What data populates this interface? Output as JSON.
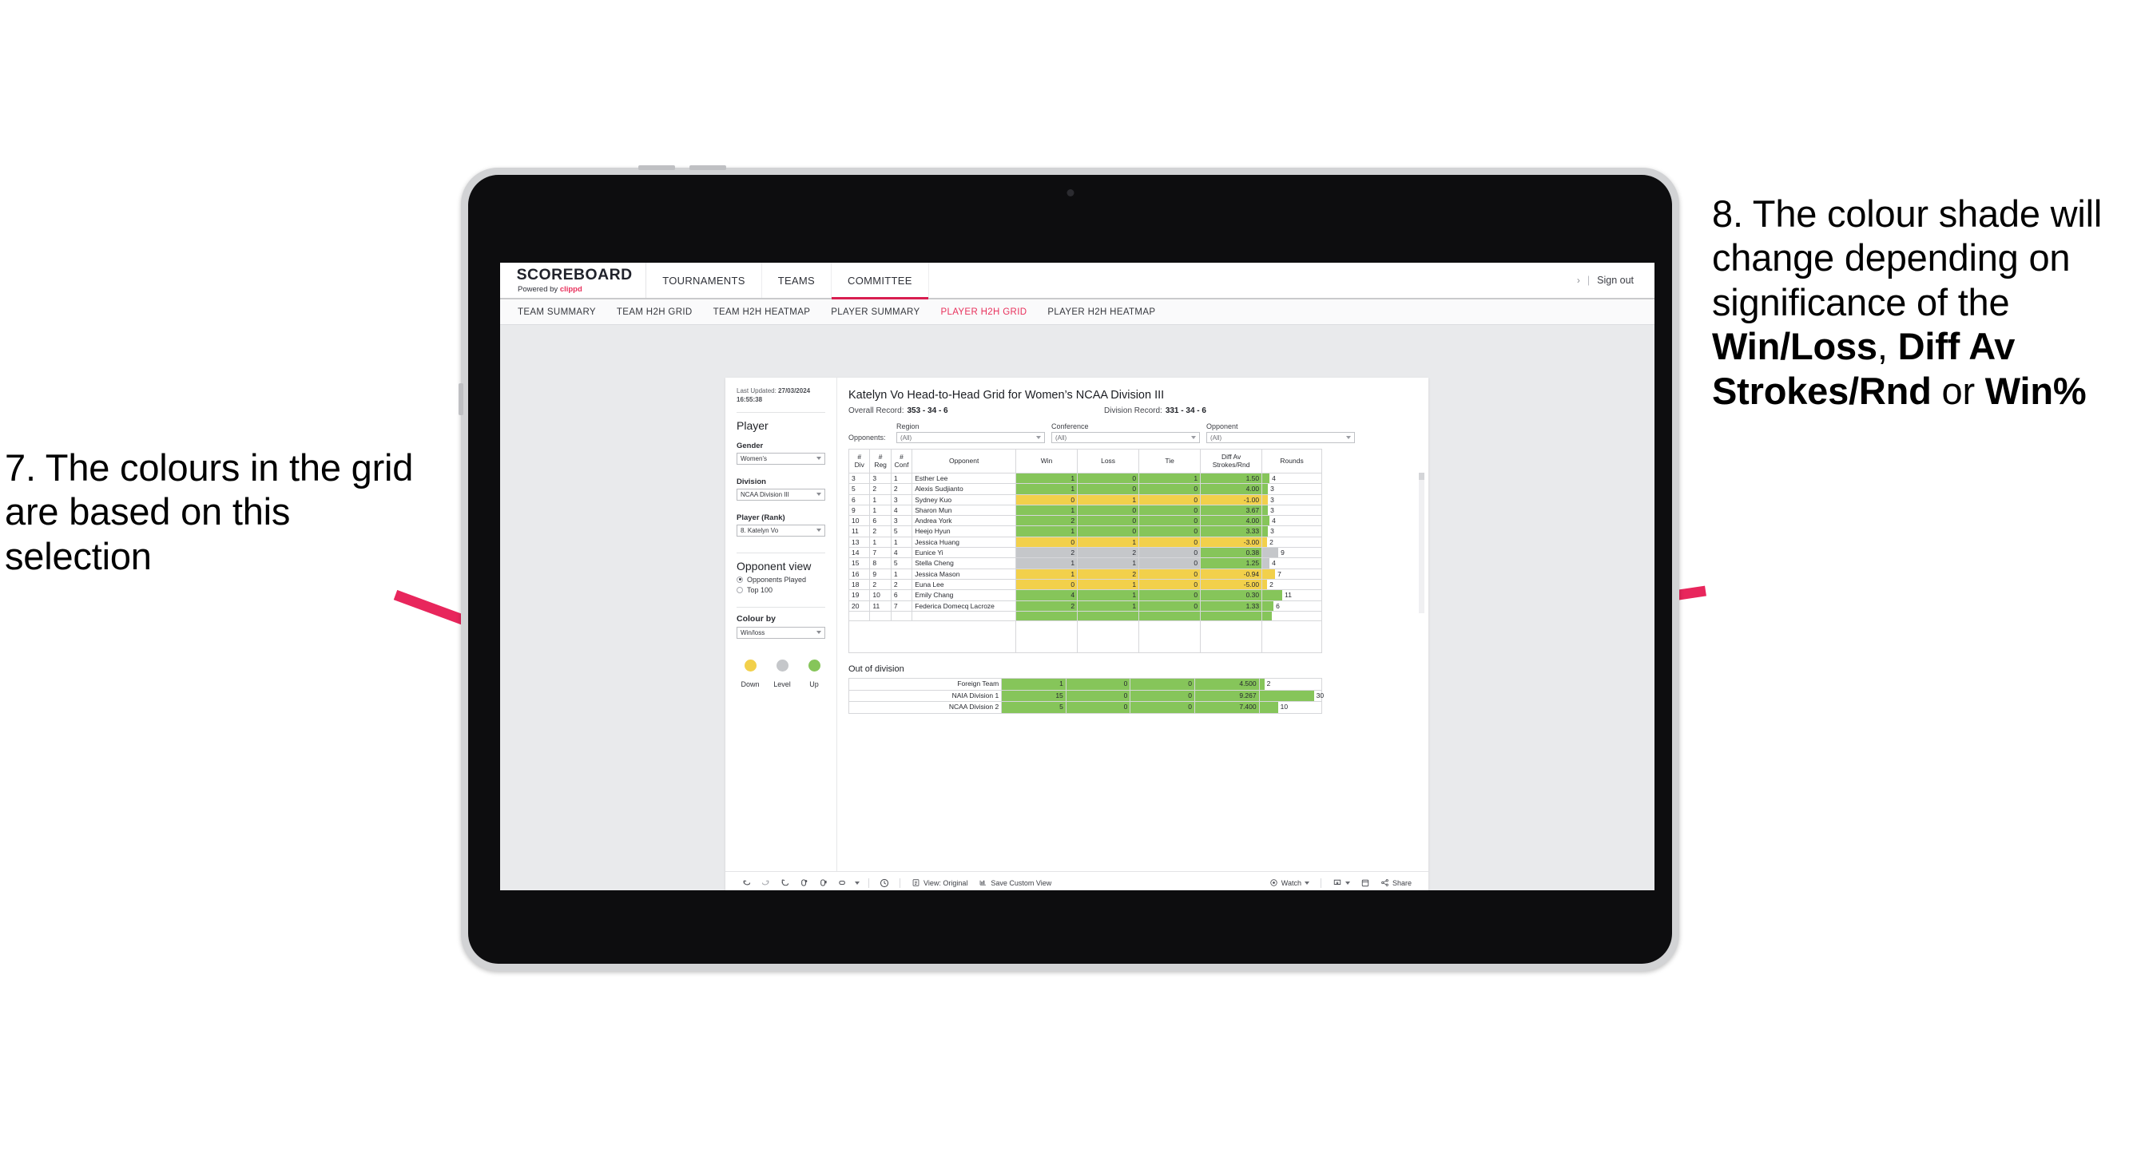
{
  "annotations": {
    "left": {
      "id": "annotation-7",
      "text": "7. The colours in the grid are based on this selection"
    },
    "right": {
      "id": "annotation-8",
      "line1": "8. The colour shade will change depending on significance of the ",
      "bold1": "Win/Loss",
      "mid1": ", ",
      "bold2": "Diff Av Strokes/Rnd",
      "mid2": " or ",
      "bold3": "Win%"
    },
    "arrow_color": "#e8265c"
  },
  "topnav": {
    "brand_title": "SCOREBOARD",
    "brand_sub_prefix": "Powered by ",
    "brand_sub_name": "clippd",
    "items": [
      {
        "label": "TOURNAMENTS",
        "active": false
      },
      {
        "label": "TEAMS",
        "active": false
      },
      {
        "label": "COMMITTEE",
        "active": true
      }
    ],
    "chevron": "›",
    "divider": "|",
    "signout": "Sign out",
    "accent": "#d81e50"
  },
  "subnav": {
    "items": [
      {
        "label": "TEAM SUMMARY",
        "active": false
      },
      {
        "label": "TEAM H2H GRID",
        "active": false
      },
      {
        "label": "TEAM H2H HEATMAP",
        "active": false
      },
      {
        "label": "PLAYER SUMMARY",
        "active": false
      },
      {
        "label": "PLAYER H2H GRID",
        "active": true
      },
      {
        "label": "PLAYER H2H HEATMAP",
        "active": false
      }
    ]
  },
  "sidebar": {
    "last_updated_label": "Last Updated: ",
    "last_updated_value": "27/03/2024 16:55:38",
    "player_heading": "Player",
    "gender_label": "Gender",
    "gender_value": "Women’s",
    "division_label": "Division",
    "division_value": "NCAA Division III",
    "player_rank_label": "Player (Rank)",
    "player_rank_value": "8. Katelyn Vo",
    "opponent_view_heading": "Opponent view",
    "opponent_view_options": [
      {
        "label": "Opponents Played",
        "selected": true
      },
      {
        "label": "Top 100",
        "selected": false
      }
    ],
    "colour_by_label": "Colour by",
    "colour_by_value": "Win/loss",
    "legend": [
      {
        "caption": "Down",
        "color": "#f2d04b"
      },
      {
        "caption": "Level",
        "color": "#c5c7ca"
      },
      {
        "caption": "Up",
        "color": "#86c55a"
      }
    ]
  },
  "viz": {
    "title": "Katelyn Vo Head-to-Head Grid for Women’s NCAA Division III",
    "overall_record_label": "Overall Record:",
    "overall_record_value": "353 -  34 - 6",
    "division_record_label": "Division Record:",
    "division_record_value": "331 -  34 - 6",
    "opponents_label": "Opponents:",
    "filters": [
      {
        "caption": "Region",
        "value": "(All)"
      },
      {
        "caption": "Conference",
        "value": "(All)"
      },
      {
        "caption": "Opponent",
        "value": "(All)"
      }
    ],
    "columns": [
      {
        "l1": "#",
        "l2": "Div"
      },
      {
        "l1": "#",
        "l2": "Reg"
      },
      {
        "l1": "#",
        "l2": "Conf"
      },
      {
        "l1": "Opponent",
        "l2": ""
      },
      {
        "l1": "Win",
        "l2": ""
      },
      {
        "l1": "Loss",
        "l2": ""
      },
      {
        "l1": "Tie",
        "l2": ""
      },
      {
        "l1": "Diff Av",
        "l2": "Strokes/Rnd"
      },
      {
        "l1": "Rounds",
        "l2": ""
      }
    ],
    "out_of_division_title": "Out of division"
  },
  "chart_data": {
    "type": "table",
    "title": "Katelyn Vo Head-to-Head Grid for Women’s NCAA Division III",
    "columns": [
      "# Div",
      "# Reg",
      "# Conf",
      "Opponent",
      "Win",
      "Loss",
      "Tie",
      "Diff Av Strokes/Rnd",
      "Rounds"
    ],
    "colour_scale": {
      "up": "#86c55a",
      "level": "#c5c7ca",
      "down": "#f2d04b"
    },
    "rounds_max": 30,
    "rows": [
      {
        "div": "3",
        "reg": "3",
        "conf": "1",
        "opponent": "Esther Lee",
        "win": "1",
        "loss": "0",
        "tie": "1",
        "diff": "1.50",
        "rounds": "4",
        "color": "up"
      },
      {
        "div": "5",
        "reg": "2",
        "conf": "2",
        "opponent": "Alexis Sudjianto",
        "win": "1",
        "loss": "0",
        "tie": "0",
        "diff": "4.00",
        "rounds": "3",
        "color": "up"
      },
      {
        "div": "6",
        "reg": "1",
        "conf": "3",
        "opponent": "Sydney Kuo",
        "win": "0",
        "loss": "1",
        "tie": "0",
        "diff": "-1.00",
        "rounds": "3",
        "color": "down"
      },
      {
        "div": "9",
        "reg": "1",
        "conf": "4",
        "opponent": "Sharon Mun",
        "win": "1",
        "loss": "0",
        "tie": "0",
        "diff": "3.67",
        "rounds": "3",
        "color": "up"
      },
      {
        "div": "10",
        "reg": "6",
        "conf": "3",
        "opponent": "Andrea York",
        "win": "2",
        "loss": "0",
        "tie": "0",
        "diff": "4.00",
        "rounds": "4",
        "color": "up"
      },
      {
        "div": "11",
        "reg": "2",
        "conf": "5",
        "opponent": "Heejo Hyun",
        "win": "1",
        "loss": "0",
        "tie": "0",
        "diff": "3.33",
        "rounds": "3",
        "color": "up"
      },
      {
        "div": "13",
        "reg": "1",
        "conf": "1",
        "opponent": "Jessica Huang",
        "win": "0",
        "loss": "1",
        "tie": "0",
        "diff": "-3.00",
        "rounds": "2",
        "color": "down"
      },
      {
        "div": "14",
        "reg": "7",
        "conf": "4",
        "opponent": "Eunice Yi",
        "win": "2",
        "loss": "2",
        "tie": "0",
        "diff": "0.38",
        "rounds": "9",
        "color": "level",
        "diff_color": "up"
      },
      {
        "div": "15",
        "reg": "8",
        "conf": "5",
        "opponent": "Stella Cheng",
        "win": "1",
        "loss": "1",
        "tie": "0",
        "diff": "1.25",
        "rounds": "4",
        "color": "level",
        "diff_color": "up"
      },
      {
        "div": "16",
        "reg": "9",
        "conf": "1",
        "opponent": "Jessica Mason",
        "win": "1",
        "loss": "2",
        "tie": "0",
        "diff": "-0.94",
        "rounds": "7",
        "color": "down"
      },
      {
        "div": "18",
        "reg": "2",
        "conf": "2",
        "opponent": "Euna Lee",
        "win": "0",
        "loss": "1",
        "tie": "0",
        "diff": "-5.00",
        "rounds": "2",
        "color": "down"
      },
      {
        "div": "19",
        "reg": "10",
        "conf": "6",
        "opponent": "Emily Chang",
        "win": "4",
        "loss": "1",
        "tie": "0",
        "diff": "0.30",
        "rounds": "11",
        "color": "up"
      },
      {
        "div": "20",
        "reg": "11",
        "conf": "7",
        "opponent": "Federica Domecq Lacroze",
        "win": "2",
        "loss": "1",
        "tie": "0",
        "diff": "1.33",
        "rounds": "6",
        "color": "up"
      }
    ],
    "out_of_division": [
      {
        "name": "Foreign Team",
        "win": "1",
        "loss": "0",
        "tie": "0",
        "diff": "4.500",
        "rounds": "2",
        "color": "up"
      },
      {
        "name": "NAIA Division 1",
        "win": "15",
        "loss": "0",
        "tie": "0",
        "diff": "9.267",
        "rounds": "30",
        "color": "up"
      },
      {
        "name": "NCAA Division 2",
        "win": "5",
        "loss": "0",
        "tie": "0",
        "diff": "7.400",
        "rounds": "10",
        "color": "up"
      }
    ]
  },
  "toolbar": {
    "icons": [
      "undo-icon",
      "redo-icon",
      "revert-icon",
      "refresh-icon",
      "pause-icon",
      "highlight-icon"
    ],
    "clock_icon": "clock-icon",
    "view_label": "View: Original",
    "save_label": "Save Custom View",
    "watch_label": "Watch",
    "share_label": "Share"
  }
}
